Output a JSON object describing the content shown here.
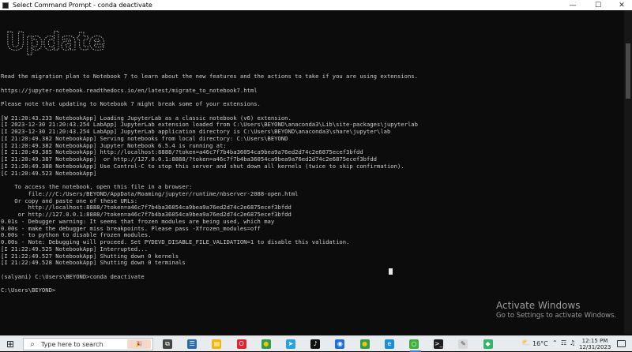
{
  "window": {
    "title": "Select Command Prompt - conda  deactivate",
    "minimize_glyph": "—",
    "maximize_glyph": "☐",
    "close_glyph": "✕"
  },
  "banner": {
    "text": "Update"
  },
  "console_lines": [
    "Read the migration plan to Notebook 7 to learn about the new features and the actions to take if you are using extensions.",
    "",
    "https://jupyter-notebook.readthedocs.io/en/latest/migrate_to_notebook7.html",
    "",
    "Please note that updating to Notebook 7 might break some of your extensions.",
    "",
    "[W 21:20:43.233 NotebookApp] Loading JupyterLab as a classic notebook (v6) extension.",
    "[I 2023-12-30 21:20:43.254 LabApp] JupyterLab extension loaded from C:\\Users\\BEYOND\\anaconda3\\Lib\\site-packages\\jupyterlab",
    "[I 2023-12-30 21:20:43.254 LabApp] JupyterLab application directory is C:\\Users\\BEYOND\\anaconda3\\share\\jupyter\\lab",
    "[I 21:20:49.382 NotebookApp] Serving notebooks from local directory: C:\\Users\\BEYOND",
    "[I 21:20:49.382 NotebookApp] Jupyter Notebook 6.5.4 is running at:",
    "[I 21:20:49.385 NotebookApp] http://localhost:8888/?token=a46c7f7b4ba36054ca9bea9a76ed2d74c2e6875ecef3bfdd",
    "[I 21:20:49.387 NotebookApp]  or http://127.0.0.1:8888/?token=a46c7f7b4ba36054ca9bea9a76ed2d74c2e6875ecef3bfdd",
    "[I 21:20:49.388 NotebookApp] Use Control-C to stop this server and shut down all kernels (twice to skip confirmation).",
    "[C 21:20:49.523 NotebookApp]",
    "",
    "    To access the notebook, open this file in a browser:",
    "        file:///C:/Users/BEYOND/AppData/Roaming/jupyter/runtime/nbserver-2088-open.html",
    "    Or copy and paste one of these URLs:",
    "        http://localhost:8888/?token=a46c7f7b4ba36054ca9bea9a76ed2d74c2e6875ecef3bfdd",
    "     or http://127.0.0.1:8888/?token=a46c7f7b4ba36054ca9bea9a76ed2d74c2e6875ecef3bfdd",
    "0.01s - Debugger warning: It seems that frozen modules are being used, which may",
    "0.00s - make the debugger miss breakpoints. Please pass -Xfrozen_modules=off",
    "0.00s - to python to disable frozen modules.",
    "0.00s - Note: Debugging will proceed. Set PYDEVD_DISABLE_FILE_VALIDATION=1 to disable this validation.",
    "[I 21:22:49.525 NotebookApp] Interrupted...",
    "[I 21:22:49.527 NotebookApp] Shutting down 0 kernels",
    "[I 21:22:49.528 NotebookApp] Shutting down 0 terminals",
    "",
    "(salyani) C:\\Users\\BEYOND>conda deactivate",
    "",
    "C:\\Users\\BEYOND>"
  ],
  "watermark": {
    "title": "Activate Windows",
    "subtitle": "Go to Settings to activate Windows."
  },
  "taskbar": {
    "start_glyph": "⊞",
    "search_icon_glyph": "⌕",
    "search_placeholder": "Type here to search",
    "promo_glyph": "🎉",
    "apps": [
      {
        "name": "task-view",
        "glyph": "⧉",
        "color": "#444444",
        "fg": "#ffffff"
      },
      {
        "name": "widgets",
        "glyph": "☰",
        "color": "#2b6cb0",
        "fg": "#ffffff"
      },
      {
        "name": "file-explorer",
        "glyph": "▤",
        "color": "#f2b705",
        "fg": "#ffffff"
      },
      {
        "name": "opera",
        "glyph": "O",
        "color": "#e0242e",
        "fg": "#ffffff"
      },
      {
        "name": "chrome",
        "glyph": "●",
        "color": "#2e9d4c",
        "fg": "#f5c400"
      },
      {
        "name": "telegram",
        "glyph": "➤",
        "color": "#2aa3dc",
        "fg": "#ffffff"
      },
      {
        "name": "tiktok",
        "glyph": "♪",
        "color": "#111111",
        "fg": "#ffffff"
      },
      {
        "name": "camera",
        "glyph": "◉",
        "color": "#1f6fd6",
        "fg": "#ffffff"
      },
      {
        "name": "chrome-2",
        "glyph": "●",
        "color": "#2e9d4c",
        "fg": "#f5c400"
      },
      {
        "name": "edge",
        "glyph": "e",
        "color": "#1b8fd6",
        "fg": "#ffffff"
      },
      {
        "name": "ring-app",
        "glyph": "○",
        "color": "#3fae3a",
        "fg": "#ffffff"
      },
      {
        "name": "command-prompt",
        "glyph": ">_",
        "color": "#1e1e1e",
        "fg": "#ffffff"
      },
      {
        "name": "paint",
        "glyph": "✎",
        "color": "#d8d8d8",
        "fg": "#444444"
      },
      {
        "name": "git-app",
        "glyph": "◆",
        "color": "#35b36b",
        "fg": "#ffffff"
      }
    ],
    "weather_glyph": "⛅",
    "temperature": "16°C",
    "tray_chevron": "⌃",
    "network_glyph": "☶",
    "volume_glyph": "♫",
    "time": "12:15 PM",
    "date": "12/31/2023",
    "notification_glyph": ""
  }
}
